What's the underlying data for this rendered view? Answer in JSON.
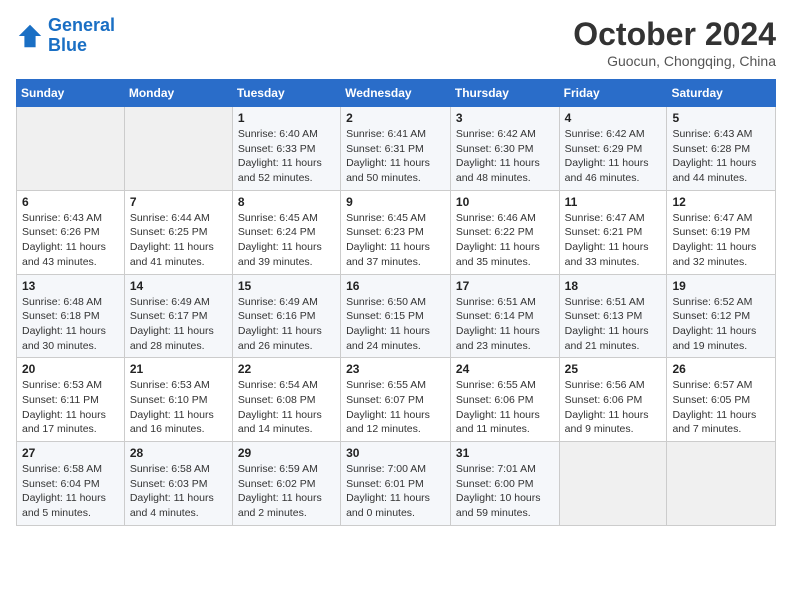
{
  "header": {
    "logo_line1": "General",
    "logo_line2": "Blue",
    "month": "October 2024",
    "location": "Guocun, Chongqing, China"
  },
  "days_of_week": [
    "Sunday",
    "Monday",
    "Tuesday",
    "Wednesday",
    "Thursday",
    "Friday",
    "Saturday"
  ],
  "weeks": [
    [
      {
        "day": "",
        "sunrise": "",
        "sunset": "",
        "daylight": ""
      },
      {
        "day": "",
        "sunrise": "",
        "sunset": "",
        "daylight": ""
      },
      {
        "day": "1",
        "sunrise": "Sunrise: 6:40 AM",
        "sunset": "Sunset: 6:33 PM",
        "daylight": "Daylight: 11 hours and 52 minutes."
      },
      {
        "day": "2",
        "sunrise": "Sunrise: 6:41 AM",
        "sunset": "Sunset: 6:31 PM",
        "daylight": "Daylight: 11 hours and 50 minutes."
      },
      {
        "day": "3",
        "sunrise": "Sunrise: 6:42 AM",
        "sunset": "Sunset: 6:30 PM",
        "daylight": "Daylight: 11 hours and 48 minutes."
      },
      {
        "day": "4",
        "sunrise": "Sunrise: 6:42 AM",
        "sunset": "Sunset: 6:29 PM",
        "daylight": "Daylight: 11 hours and 46 minutes."
      },
      {
        "day": "5",
        "sunrise": "Sunrise: 6:43 AM",
        "sunset": "Sunset: 6:28 PM",
        "daylight": "Daylight: 11 hours and 44 minutes."
      }
    ],
    [
      {
        "day": "6",
        "sunrise": "Sunrise: 6:43 AM",
        "sunset": "Sunset: 6:26 PM",
        "daylight": "Daylight: 11 hours and 43 minutes."
      },
      {
        "day": "7",
        "sunrise": "Sunrise: 6:44 AM",
        "sunset": "Sunset: 6:25 PM",
        "daylight": "Daylight: 11 hours and 41 minutes."
      },
      {
        "day": "8",
        "sunrise": "Sunrise: 6:45 AM",
        "sunset": "Sunset: 6:24 PM",
        "daylight": "Daylight: 11 hours and 39 minutes."
      },
      {
        "day": "9",
        "sunrise": "Sunrise: 6:45 AM",
        "sunset": "Sunset: 6:23 PM",
        "daylight": "Daylight: 11 hours and 37 minutes."
      },
      {
        "day": "10",
        "sunrise": "Sunrise: 6:46 AM",
        "sunset": "Sunset: 6:22 PM",
        "daylight": "Daylight: 11 hours and 35 minutes."
      },
      {
        "day": "11",
        "sunrise": "Sunrise: 6:47 AM",
        "sunset": "Sunset: 6:21 PM",
        "daylight": "Daylight: 11 hours and 33 minutes."
      },
      {
        "day": "12",
        "sunrise": "Sunrise: 6:47 AM",
        "sunset": "Sunset: 6:19 PM",
        "daylight": "Daylight: 11 hours and 32 minutes."
      }
    ],
    [
      {
        "day": "13",
        "sunrise": "Sunrise: 6:48 AM",
        "sunset": "Sunset: 6:18 PM",
        "daylight": "Daylight: 11 hours and 30 minutes."
      },
      {
        "day": "14",
        "sunrise": "Sunrise: 6:49 AM",
        "sunset": "Sunset: 6:17 PM",
        "daylight": "Daylight: 11 hours and 28 minutes."
      },
      {
        "day": "15",
        "sunrise": "Sunrise: 6:49 AM",
        "sunset": "Sunset: 6:16 PM",
        "daylight": "Daylight: 11 hours and 26 minutes."
      },
      {
        "day": "16",
        "sunrise": "Sunrise: 6:50 AM",
        "sunset": "Sunset: 6:15 PM",
        "daylight": "Daylight: 11 hours and 24 minutes."
      },
      {
        "day": "17",
        "sunrise": "Sunrise: 6:51 AM",
        "sunset": "Sunset: 6:14 PM",
        "daylight": "Daylight: 11 hours and 23 minutes."
      },
      {
        "day": "18",
        "sunrise": "Sunrise: 6:51 AM",
        "sunset": "Sunset: 6:13 PM",
        "daylight": "Daylight: 11 hours and 21 minutes."
      },
      {
        "day": "19",
        "sunrise": "Sunrise: 6:52 AM",
        "sunset": "Sunset: 6:12 PM",
        "daylight": "Daylight: 11 hours and 19 minutes."
      }
    ],
    [
      {
        "day": "20",
        "sunrise": "Sunrise: 6:53 AM",
        "sunset": "Sunset: 6:11 PM",
        "daylight": "Daylight: 11 hours and 17 minutes."
      },
      {
        "day": "21",
        "sunrise": "Sunrise: 6:53 AM",
        "sunset": "Sunset: 6:10 PM",
        "daylight": "Daylight: 11 hours and 16 minutes."
      },
      {
        "day": "22",
        "sunrise": "Sunrise: 6:54 AM",
        "sunset": "Sunset: 6:08 PM",
        "daylight": "Daylight: 11 hours and 14 minutes."
      },
      {
        "day": "23",
        "sunrise": "Sunrise: 6:55 AM",
        "sunset": "Sunset: 6:07 PM",
        "daylight": "Daylight: 11 hours and 12 minutes."
      },
      {
        "day": "24",
        "sunrise": "Sunrise: 6:55 AM",
        "sunset": "Sunset: 6:06 PM",
        "daylight": "Daylight: 11 hours and 11 minutes."
      },
      {
        "day": "25",
        "sunrise": "Sunrise: 6:56 AM",
        "sunset": "Sunset: 6:06 PM",
        "daylight": "Daylight: 11 hours and 9 minutes."
      },
      {
        "day": "26",
        "sunrise": "Sunrise: 6:57 AM",
        "sunset": "Sunset: 6:05 PM",
        "daylight": "Daylight: 11 hours and 7 minutes."
      }
    ],
    [
      {
        "day": "27",
        "sunrise": "Sunrise: 6:58 AM",
        "sunset": "Sunset: 6:04 PM",
        "daylight": "Daylight: 11 hours and 5 minutes."
      },
      {
        "day": "28",
        "sunrise": "Sunrise: 6:58 AM",
        "sunset": "Sunset: 6:03 PM",
        "daylight": "Daylight: 11 hours and 4 minutes."
      },
      {
        "day": "29",
        "sunrise": "Sunrise: 6:59 AM",
        "sunset": "Sunset: 6:02 PM",
        "daylight": "Daylight: 11 hours and 2 minutes."
      },
      {
        "day": "30",
        "sunrise": "Sunrise: 7:00 AM",
        "sunset": "Sunset: 6:01 PM",
        "daylight": "Daylight: 11 hours and 0 minutes."
      },
      {
        "day": "31",
        "sunrise": "Sunrise: 7:01 AM",
        "sunset": "Sunset: 6:00 PM",
        "daylight": "Daylight: 10 hours and 59 minutes."
      },
      {
        "day": "",
        "sunrise": "",
        "sunset": "",
        "daylight": ""
      },
      {
        "day": "",
        "sunrise": "",
        "sunset": "",
        "daylight": ""
      }
    ]
  ]
}
